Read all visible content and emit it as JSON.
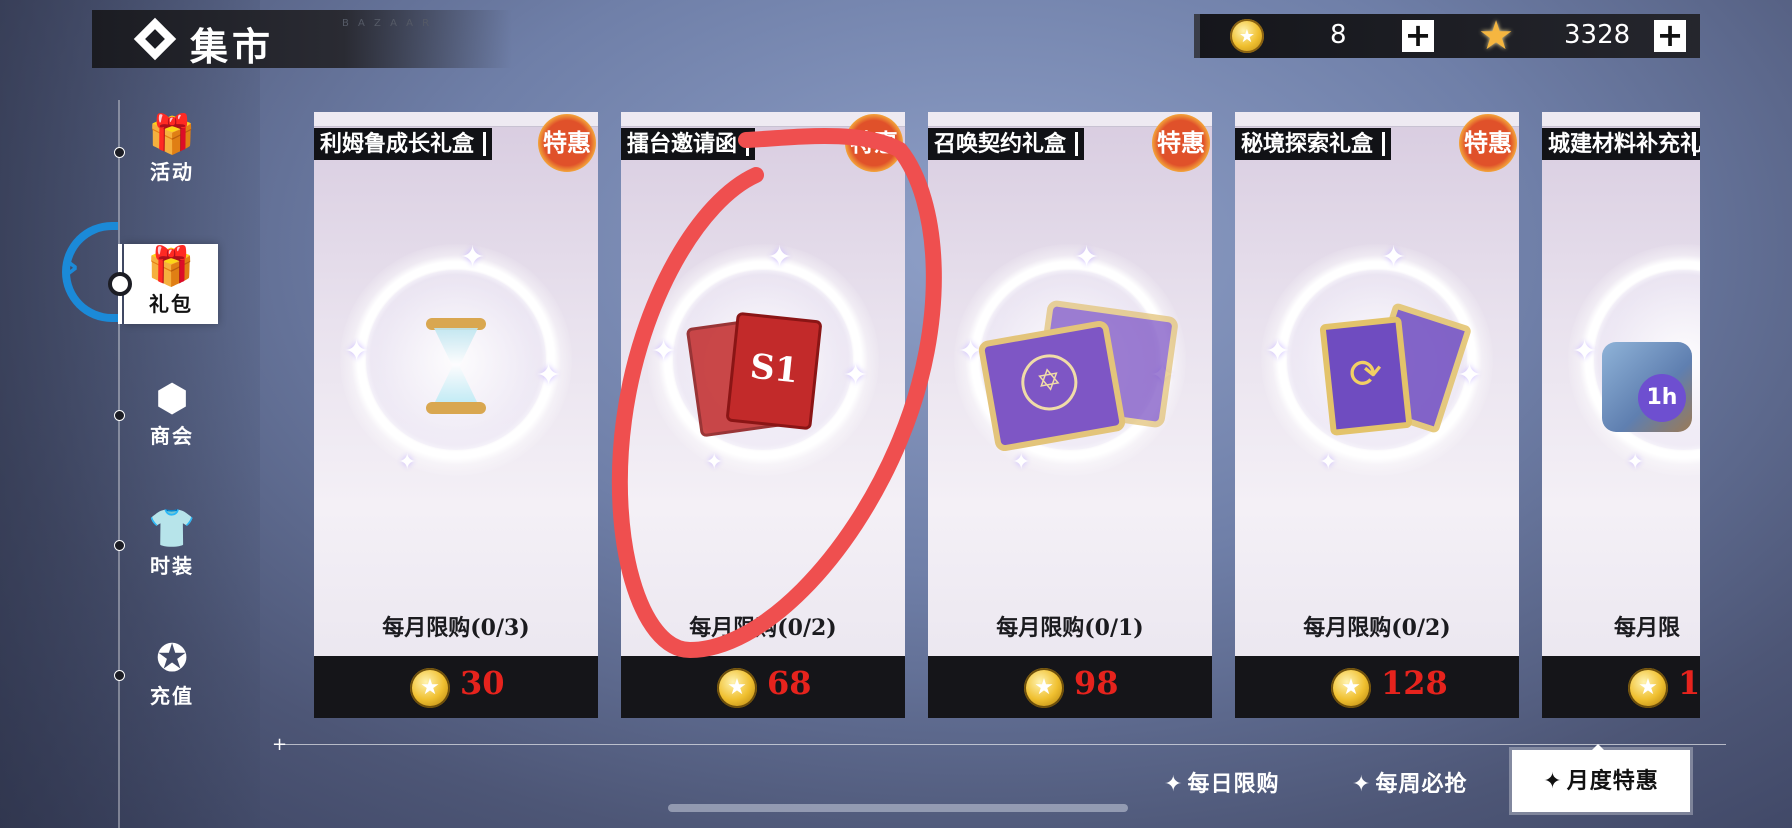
{
  "header": {
    "title": "集市",
    "subtitle": "B A Z A A R"
  },
  "currency": [
    {
      "icon": "gold-coin-icon",
      "value": "8"
    },
    {
      "icon": "star-currency-icon",
      "value": "3328"
    }
  ],
  "sidebar": {
    "items": [
      {
        "label": "活动",
        "icon": "gift-icon"
      },
      {
        "label": "礼包",
        "icon": "gift-box-icon",
        "active": true
      },
      {
        "label": "商会",
        "icon": "cube-icon"
      },
      {
        "label": "时装",
        "icon": "shirt-icon"
      },
      {
        "label": "充值",
        "icon": "star-circle-icon"
      }
    ]
  },
  "cards": [
    {
      "name": "利姆鲁成长礼盒",
      "badge": "特惠",
      "limit": "每月限购(0/3)",
      "price": "30",
      "item_icon": "hourglass-icon"
    },
    {
      "name": "擂台邀请函",
      "badge": "特惠",
      "limit": "每月限购(0/2)",
      "price": "68",
      "item_icon": "s1-card-icon",
      "card_text": "S1"
    },
    {
      "name": "召唤契约礼盒",
      "badge": "特惠",
      "limit": "每月限购(0/1)",
      "price": "98",
      "item_icon": "summon-book-icon"
    },
    {
      "name": "秘境探索礼盒",
      "badge": "特惠",
      "limit": "每月限购(0/2)",
      "price": "128",
      "item_icon": "swap-card-icon"
    },
    {
      "name": "城建材料补充礼",
      "badge": "",
      "limit": "每月限",
      "price": "1",
      "item_icon": "materials-icon",
      "label_1h": "1h"
    }
  ],
  "tabs": [
    {
      "label": "每日限购"
    },
    {
      "label": "每周必抢"
    },
    {
      "label": "月度特惠",
      "active": true
    }
  ],
  "colors": {
    "price": "#e6231d",
    "active_indicator": "#1b8ad8",
    "badge": "#e0512a",
    "annotation": "#ef4f4f"
  }
}
